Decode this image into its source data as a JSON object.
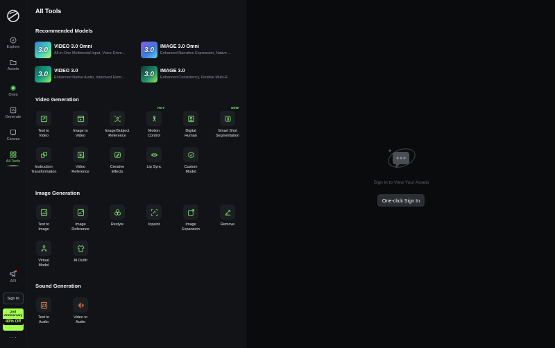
{
  "rail": {
    "items": [
      {
        "label": "Explore",
        "icon": "compass-icon"
      },
      {
        "label": "Assets",
        "icon": "folder-icon"
      },
      {
        "label": "Omni",
        "icon": "omni-icon"
      },
      {
        "label": "Generate",
        "icon": "generate-icon"
      },
      {
        "label": "Canvas",
        "icon": "canvas-icon"
      },
      {
        "label": "All Tools",
        "icon": "grid-icon",
        "active": true
      },
      {
        "label": "API",
        "icon": "megaphone-icon"
      }
    ],
    "sign_in": "Sign In",
    "promo": {
      "line1": "2nd",
      "line2": "Anniversary",
      "off": "40% Off"
    },
    "more": "···"
  },
  "panel": {
    "title": "All Tools",
    "recommended": {
      "title": "Recommended Models",
      "models": [
        {
          "badge": "3.0",
          "name": "VIDEO 3.0 Omni",
          "desc": "All-in-One Multimodal Input, Voice-Drive..."
        },
        {
          "badge": "3.0",
          "name": "IMAGE 3.0 Omni",
          "desc": "Enhanced Narrative Expression, Native ..."
        },
        {
          "badge": "3.0",
          "name": "VIDEO 3.0",
          "desc": "Enhanced Native Audio, Improved Elem..."
        },
        {
          "badge": "3.0",
          "name": "IMAGE 3.0",
          "desc": "Enhanced Consistency, Flexible Multi-R..."
        }
      ]
    },
    "video": {
      "title": "Video Generation",
      "tools": [
        {
          "label": "Text to\nVideo",
          "tag": ""
        },
        {
          "label": "Image to\nVideo",
          "tag": ""
        },
        {
          "label": "Image/Subject\nReference",
          "tag": ""
        },
        {
          "label": "Motion\nControl",
          "tag": "HOT"
        },
        {
          "label": "Digital\nHuman",
          "tag": ""
        },
        {
          "label": "Smart Shot\nSegmentation",
          "tag": "NEW"
        },
        {
          "label": "Instruction\nTransformation",
          "tag": ""
        },
        {
          "label": "Video\nReference",
          "tag": ""
        },
        {
          "label": "Creative\nEffects",
          "tag": ""
        },
        {
          "label": "Lip Sync",
          "tag": ""
        },
        {
          "label": "Custom\nModel",
          "tag": ""
        }
      ]
    },
    "image": {
      "title": "Image Generation",
      "tools": [
        {
          "label": "Text to\nImage"
        },
        {
          "label": "Image\nReference"
        },
        {
          "label": "Restyle"
        },
        {
          "label": "Inpaint"
        },
        {
          "label": "Image\nExpansion"
        },
        {
          "label": "Remove"
        },
        {
          "label": "Virtual\nModel"
        },
        {
          "label": "AI Outfit"
        }
      ]
    },
    "sound": {
      "title": "Sound Generation",
      "tools": [
        {
          "label": "Text to\nAudio"
        },
        {
          "label": "Video to\nAudio"
        }
      ]
    }
  },
  "assets": {
    "empty_text": "Sign in to View Your Assets",
    "sign_in_button": "One-click Sign In"
  },
  "colors": {
    "accent": "#7ee86a",
    "tool_icon": "#7ee86a",
    "sound_icon": "#f0844a",
    "promo": "#a7ff4d"
  }
}
